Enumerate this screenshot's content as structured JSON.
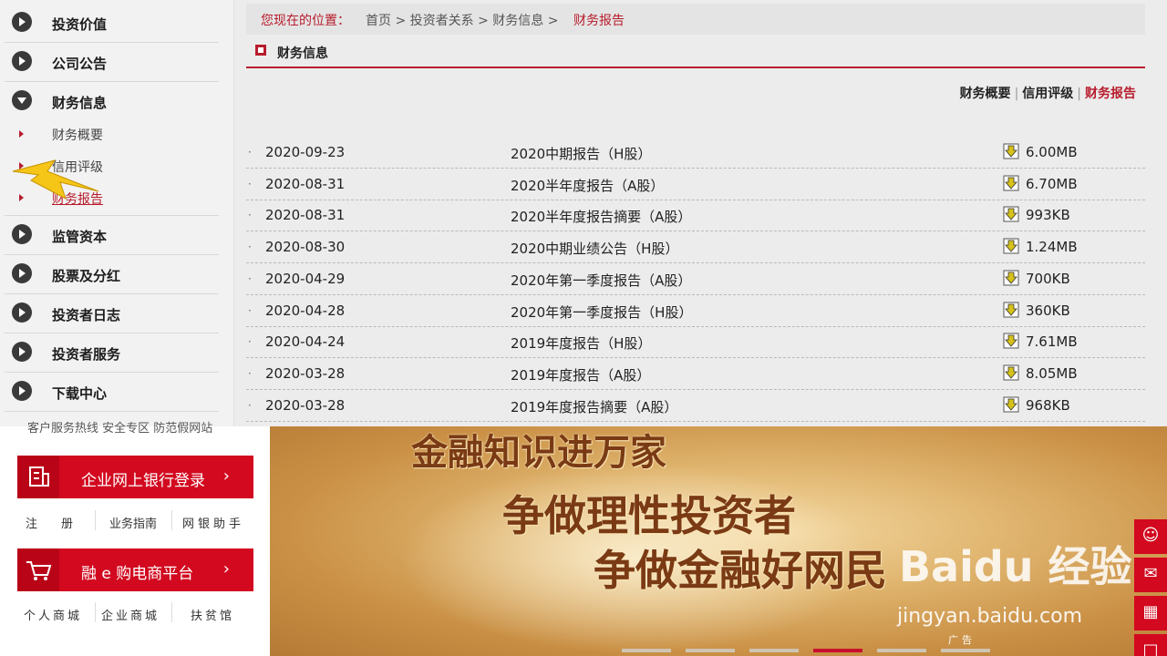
{
  "sidebar": {
    "items": [
      {
        "label": "投资价值",
        "open": false
      },
      {
        "label": "公司公告",
        "open": false
      },
      {
        "label": "财务信息",
        "open": true
      },
      {
        "label": "监管资本",
        "open": false
      },
      {
        "label": "股票及分红",
        "open": false
      },
      {
        "label": "投资者日志",
        "open": false
      },
      {
        "label": "投资者服务",
        "open": false
      },
      {
        "label": "下载中心",
        "open": false
      }
    ],
    "subitems": [
      {
        "label": "财务概要",
        "active": false
      },
      {
        "label": "信用评级",
        "active": false
      },
      {
        "label": "财务报告",
        "active": true
      }
    ]
  },
  "breadcrumb": {
    "prefix": "您现在的位置：",
    "path": "首页 > 投资者关系 > 财务信息 > ",
    "current": "财务报告"
  },
  "section": {
    "title": "财务信息"
  },
  "subtabs": [
    {
      "label": "财务概要",
      "active": false
    },
    {
      "label": "信用评级",
      "active": false
    },
    {
      "label": "财务报告",
      "active": true
    }
  ],
  "reports": [
    {
      "date": "2020-09-23",
      "title": "2020中期报告（H股）",
      "size": "6.00MB"
    },
    {
      "date": "2020-08-31",
      "title": "2020半年度报告（A股）",
      "size": "6.70MB"
    },
    {
      "date": "2020-08-31",
      "title": "2020半年度报告摘要（A股）",
      "size": "993KB"
    },
    {
      "date": "2020-08-30",
      "title": "2020中期业绩公告（H股）",
      "size": "1.24MB"
    },
    {
      "date": "2020-04-29",
      "title": "2020年第一季度报告（A股）",
      "size": "700KB"
    },
    {
      "date": "2020-04-28",
      "title": "2020年第一季度报告（H股）",
      "size": "360KB"
    },
    {
      "date": "2020-04-24",
      "title": "2019年度报告（H股）",
      "size": "7.61MB"
    },
    {
      "date": "2020-03-28",
      "title": "2019年度报告（A股）",
      "size": "8.05MB"
    },
    {
      "date": "2020-03-28",
      "title": "2019年度报告摘要（A股）",
      "size": "968KB"
    }
  ],
  "bottom_left": {
    "cut_text": "客户服务热线   安全专区   防范假网站",
    "bank_login": {
      "label": "企业网上银行登录",
      "icon": "building-icon"
    },
    "bank_links": [
      "注　　册",
      "业务指南",
      "网银助手"
    ],
    "ecommerce": {
      "label": "融 e 购电商平台",
      "icon": "cart-icon"
    },
    "ecommerce_links": [
      "个人商城",
      "企业商城",
      "扶贫馆"
    ]
  },
  "banner": {
    "line1": "金融知识进万家",
    "line2": "争做理性投资者",
    "line3": "争做金融好网民",
    "watermark_main": "Baidu 经验",
    "watermark_url": "jingyan.baidu.com",
    "ad_label": "广告",
    "carousel_active_index": 3
  },
  "colors": {
    "accent": "#b71c2c",
    "button_red": "#d2091f"
  }
}
